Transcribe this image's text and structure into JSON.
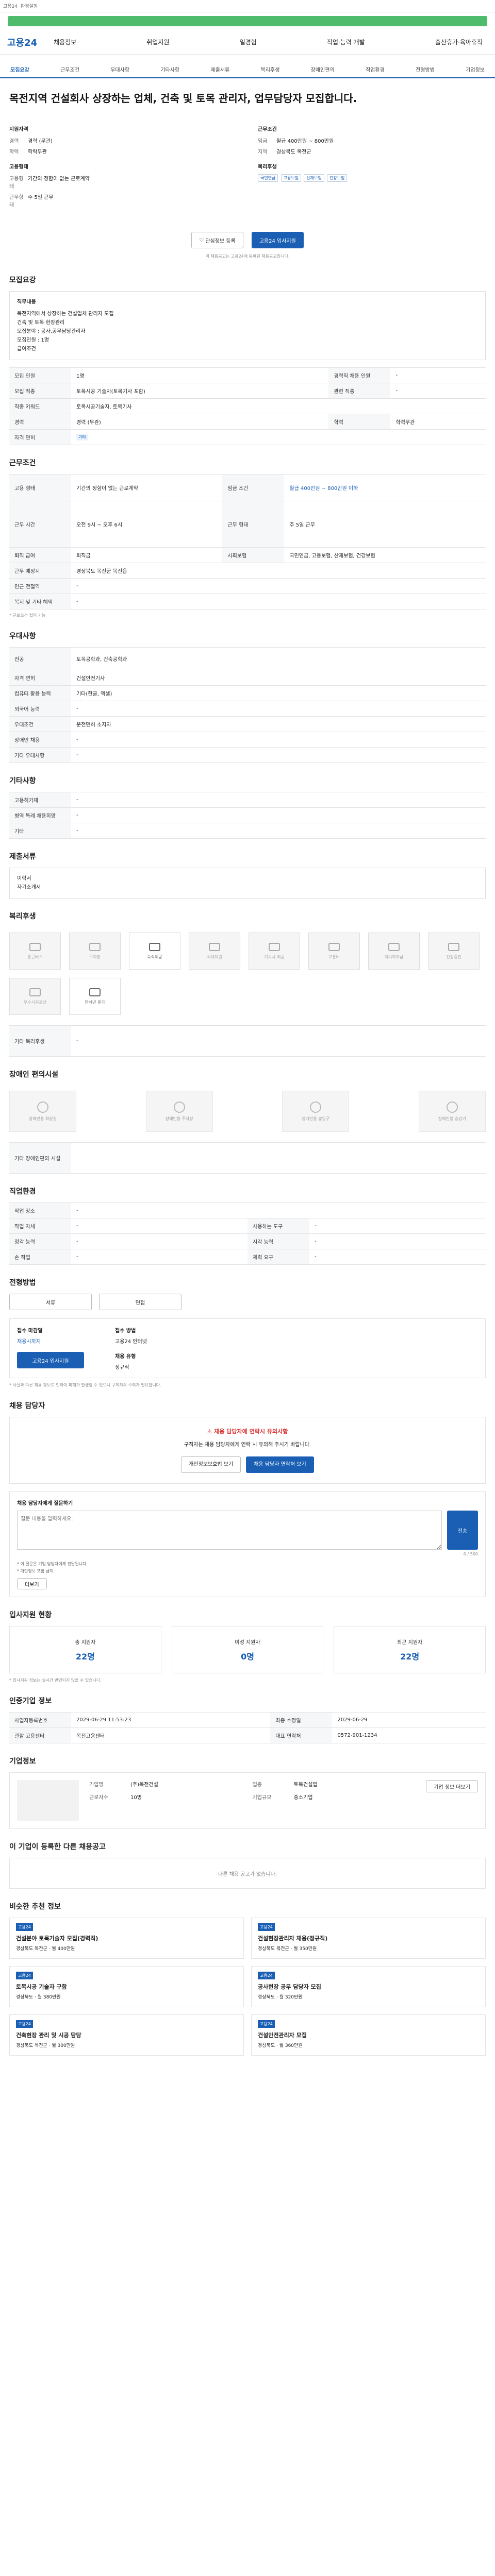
{
  "topbar": {
    "tabs": [
      "고용24",
      "환경설정"
    ]
  },
  "header": {
    "logo": "고용24",
    "gnb": [
      "채용정보",
      "취업지원",
      "일경험",
      "직업·능력 개발",
      "출산휴가·육아휴직"
    ]
  },
  "tabs": [
    "모집요강",
    "근무조건",
    "우대사항",
    "기타사항",
    "제출서류",
    "복리후생",
    "장애인편의",
    "직업환경",
    "전형방법",
    "기업정보"
  ],
  "job": {
    "title": "목전지역 건설회사 상장하는 업체, 건축 및 토목 관리자, 업무담당자 모집합니다.",
    "left_group": "지원자격",
    "right_group": "근무조건",
    "left_rows": [
      [
        "경력",
        "경력 (무관)"
      ],
      [
        "학력",
        "학력무관"
      ]
    ],
    "right_rows": [
      [
        "임금",
        "월급 400만원 ~ 800만원"
      ],
      [
        "지역",
        "경상북도 목전군"
      ]
    ],
    "left2_group": "고용형태",
    "right2_group": "복리후생",
    "left2_rows": [
      [
        "고용형태",
        "기간의 정함이 없는 근로계약"
      ],
      [
        "근무형태",
        "주 5일 근무"
      ]
    ],
    "right2_tags": [
      "국민연금",
      "고용보험",
      "산재보험",
      "건강보험"
    ],
    "btn_interest": "관심정보 등록",
    "btn_apply": "고용24 입사지원",
    "note": "이 채용공고는 고용24에 등록된 채용공고입니다."
  },
  "recruit": {
    "title": "모집요강",
    "box_title": "직무내용",
    "box_lines": [
      "목전지역에서 상장하는 건설업체 관리자 모집",
      "건축 및 토목 현장관리",
      "모집분야 : 공사,공무담당관리자",
      "모집인원 : 1명",
      "급여조건"
    ],
    "rows": [
      [
        "모집 인원",
        "1명",
        "경력직 채용 인원",
        "-"
      ],
      [
        "모집 직종",
        "토목시공 기술자(토목기사 포함)",
        "관련 직종",
        "-"
      ],
      [
        "직종 키워드",
        "토목시공기술자, 토목기사",
        "",
        ""
      ],
      [
        "경력",
        "경력 (무관)",
        "학력",
        "학력무관"
      ],
      [
        "자격 면허",
        "기타",
        "",
        ""
      ]
    ]
  },
  "condition": {
    "title": "근무조건",
    "rows": [
      [
        "고용 형태",
        "기간의 정함이 없는 근로계약",
        "임금 조건",
        "월급 400만원 ~ 800만원 이하"
      ],
      [
        "근무 시간",
        "오전 9시 ~ 오후 6시",
        "근무 형태",
        "주 5일 근무"
      ],
      [
        "퇴직 급여",
        "퇴직금",
        "사회보험",
        "국민연금, 고용보험, 산재보험, 건강보험"
      ],
      [
        "근무 예정지",
        "경상북도 목전군 목전읍",
        "",
        ""
      ],
      [
        "인근 전철역",
        "-",
        "",
        ""
      ],
      [
        "복지 및 기타 혜택",
        "-",
        "",
        ""
      ]
    ],
    "note": "* 근로조건 협의 가능"
  },
  "prefer": {
    "title": "우대사항",
    "rows": [
      [
        "전공",
        "토목공학과, 건축공학과"
      ],
      [
        "자격 면허",
        "건설안전기사"
      ],
      [
        "컴퓨터 활용 능력",
        "기타(한글, 엑셀)"
      ],
      [
        "외국어 능력",
        "-"
      ],
      [
        "우대조건",
        "운전면허 소지자"
      ],
      [
        "장애인 채용",
        "-"
      ],
      [
        "기타 우대사항",
        "-"
      ]
    ]
  },
  "etc": {
    "title": "기타사항",
    "rows": [
      [
        "고용허가제",
        "-"
      ],
      [
        "병역 특례 채용희망",
        "-"
      ],
      [
        "기타",
        "-"
      ]
    ]
  },
  "docs": {
    "title": "제출서류",
    "lines": [
      "이력서",
      "자기소개서"
    ]
  },
  "welfare": {
    "title": "복리후생",
    "cards": [
      "통근버스",
      "주차장",
      "숙식제공",
      "식대지원",
      "기숙사 제공",
      "교통비",
      "자녀학자금",
      "건강검진",
      "우수사원포상",
      "안식년 휴가"
    ],
    "other_label": "기타 복리후생",
    "other_value": "-"
  },
  "disabled": {
    "title": "장애인 편의시설",
    "cards": [
      "장애인용 화장실",
      "장애인용 주차장",
      "장애인용 출입구",
      "장애인용 승강기"
    ],
    "other_label": "기타 장애인편의 시설"
  },
  "env": {
    "title": "직업환경",
    "rows": [
      [
        "작업 장소",
        "-",
        "",
        ""
      ],
      [
        "작업 자세",
        "-",
        "사용하는 도구",
        "-"
      ],
      [
        "청각 능력",
        "-",
        "시각 능력",
        "-"
      ],
      [
        "손 작업",
        "-",
        "체력 요구",
        "-"
      ]
    ]
  },
  "screen": {
    "title": "전형방법",
    "steps": [
      "서류",
      "면접"
    ],
    "deadline_label": "접수 마감일",
    "deadline_value": "채용시까지",
    "method_label": "접수 방법",
    "method_value": "고용24 인터넷",
    "apply_btn": "고용24 입사지원",
    "type_label": "채용 유형",
    "type_value": "정규직",
    "notes": [
      "* 사실과 다른 채용 정보로 인하여 피해가 발생할 수 있으니 구직자의 주의가 필요합니다."
    ]
  },
  "warn": {
    "title": "채용 담당자",
    "notice": "채용 담당자에 연락시 유의사항",
    "text": "구직자는 채용 담당자에게 연락 시 유의해 주시기 바랍니다.",
    "btn1": "개인정보보호법 보기",
    "btn2": "채용 담당자 연락처 보기"
  },
  "inquiry": {
    "title": "채용 담당자에게 질문하기",
    "placeholder": "질문 내용을 입력하세요.",
    "count": "0 / 500",
    "btn": "전송",
    "notes": [
      "* 이 질문은 기업 담당자에게 전달됩니다.",
      "* 개인정보 포함 금지"
    ],
    "more": "더보기"
  },
  "stats": {
    "title": "입사지원 현황",
    "items": [
      [
        "총 지원자",
        "22명"
      ],
      [
        "여성 지원자",
        "0명"
      ],
      [
        "최근 지원자",
        "22명"
      ]
    ],
    "note": "* 입사지원 정보는 실시간 반영되지 않을 수 있습니다."
  },
  "info": {
    "title": "인증기업 정보",
    "rows": [
      [
        "사업자등록번호",
        "2029-06-29 11:53:23",
        "최종 수정일",
        "2029-06-29"
      ],
      [
        "관할 고용센터",
        "목전고용센터",
        "대표 연락처",
        "0572-901-1234"
      ]
    ]
  },
  "company": {
    "title": "기업정보",
    "rows": [
      [
        "기업명",
        "(주)목전건설"
      ],
      [
        "업종",
        "토목건설업"
      ],
      [
        "근로자수",
        "10명"
      ],
      [
        "기업규모",
        "중소기업"
      ]
    ],
    "btn": "기업 정보 더보기"
  },
  "others": {
    "title": "이 기업이 등록한 다른 채용공고",
    "empty": "다른 채용 공고가 없습니다."
  },
  "recent": {
    "title": "비슷한 추천 정보",
    "items": [
      {
        "tag": "고용24",
        "title": "건설분야 토목기술자 모집(경력직)",
        "meta": "경상북도 목전군 · 월 400만원"
      },
      {
        "tag": "고용24",
        "title": "건설현장관리자 채용(정규직)",
        "meta": "경상북도 목전군 · 월 350만원"
      },
      {
        "tag": "고용24",
        "title": "토목시공 기술자 구함",
        "meta": "경상북도 · 월 380만원"
      },
      {
        "tag": "고용24",
        "title": "공사현장 공무 담당자 모집",
        "meta": "경상북도 · 월 320만원"
      },
      {
        "tag": "고용24",
        "title": "건축현장 관리 및 시공 담당",
        "meta": "경상북도 목전군 · 월 300만원"
      },
      {
        "tag": "고용24",
        "title": "건설안전관리자 모집",
        "meta": "경상북도 · 월 360만원"
      }
    ]
  }
}
